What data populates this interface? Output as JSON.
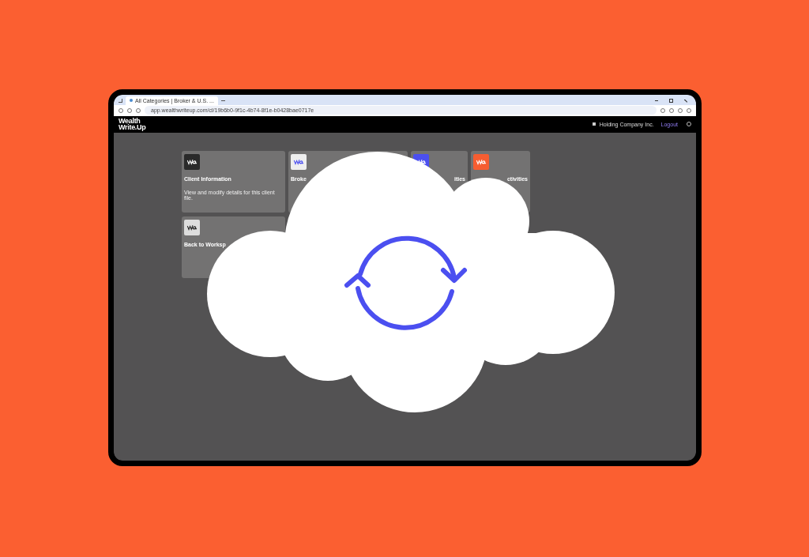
{
  "browser": {
    "tab_title": "All Categories | Broker & U.S. ...",
    "address": "app.wealthwriteup.com/cl/19b6b0-9f1c-4b74-8f1e-b0428bae0717e"
  },
  "header": {
    "logo": "Wealth\nWrite.Up",
    "company": "Holding Company Inc.",
    "logout": "Logout"
  },
  "cards": [
    {
      "title": "Client Information",
      "description": "View and modify details for this client file.",
      "color": "#2a2a2a",
      "glyph": {
        "color": "#ffffff"
      }
    },
    {
      "title": "Broke",
      "color": "#eeeeee",
      "glyph": {
        "color": "#4b4ff0"
      }
    },
    {
      "title": "ities",
      "color": "#4b4ff0",
      "glyph": {
        "color": "#ffffff"
      }
    },
    {
      "title": "ctivities",
      "color": "#f65d31",
      "glyph": {
        "color": "#ffffff"
      }
    },
    {
      "title": "Back to Worksp",
      "color": "#dddddd",
      "glyph": {
        "color": "#222222"
      }
    }
  ]
}
